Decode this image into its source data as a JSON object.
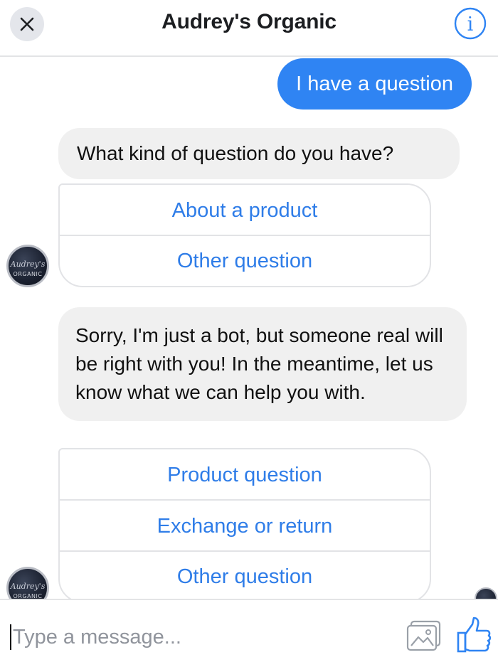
{
  "header": {
    "title": "Audrey's Organic",
    "close_icon": "close-icon",
    "info_icon": "info-icon"
  },
  "messages": {
    "user_1": "I have a question",
    "bot_1": "What kind of question do you have?",
    "quick_replies_1": [
      "About a product",
      "Other question"
    ],
    "bot_2": "Sorry, I'm just a bot, but someone real will be right with you! In the meantime, let us know what we can help you with.",
    "quick_replies_2": [
      "Product question",
      "Exchange or return",
      "Other question"
    ]
  },
  "composer": {
    "placeholder": "Type a message...",
    "image_icon": "image-icon",
    "like_icon": "thumbs-up-icon"
  },
  "colors": {
    "accent": "#2f84f3",
    "quick_reply_text": "#2f7de8",
    "bot_bubble": "#f0f0f0",
    "border": "#e2e3e6"
  }
}
